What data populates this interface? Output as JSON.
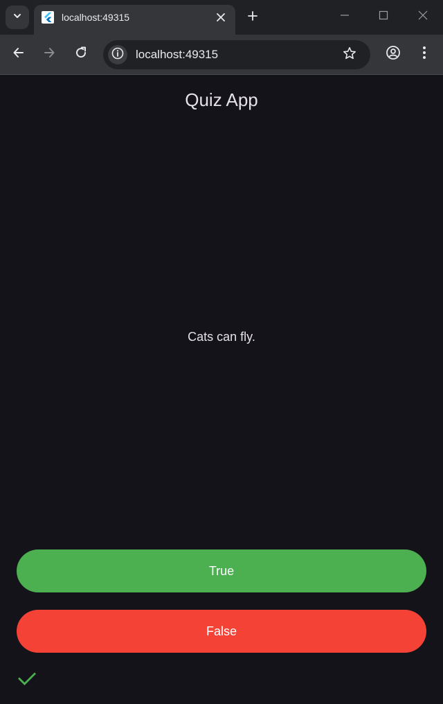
{
  "browser": {
    "tab_title": "localhost:49315",
    "url": "localhost:49315"
  },
  "app": {
    "title": "Quiz App",
    "question": "Cats can fly.",
    "true_label": "True",
    "false_label": "False",
    "score_marks": [
      "check-icon"
    ]
  },
  "colors": {
    "background": "#15131a",
    "true_button": "#4caf50",
    "false_button": "#f44336",
    "check_mark": "#4caf50"
  }
}
